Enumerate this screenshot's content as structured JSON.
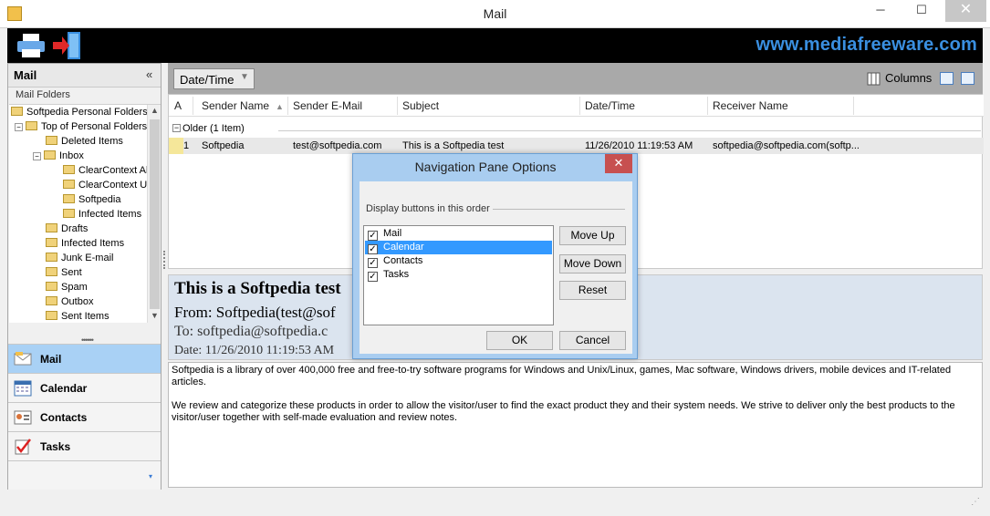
{
  "window": {
    "title": "Mail",
    "minimize": "─",
    "maximize": "☐",
    "close": "✕"
  },
  "banner": {
    "url": "www.mediafreeware.com"
  },
  "left": {
    "header": "Mail",
    "collapse": "«",
    "folders_label": "Mail Folders",
    "tree": [
      {
        "label": "Softpedia Personal Folders",
        "level": 0
      },
      {
        "label": "Top of Personal Folders",
        "level": 1
      },
      {
        "label": "Deleted Items",
        "level": 2
      },
      {
        "label": "Inbox",
        "level": 2
      },
      {
        "label": "ClearContext Al",
        "level": 3
      },
      {
        "label": "ClearContext U",
        "level": 3
      },
      {
        "label": "Softpedia",
        "level": 3
      },
      {
        "label": "Infected Items",
        "level": 3
      },
      {
        "label": "Drafts",
        "level": 2
      },
      {
        "label": "Infected Items",
        "level": 2
      },
      {
        "label": "Junk E-mail",
        "level": 2
      },
      {
        "label": "Sent",
        "level": 2
      },
      {
        "label": "Spam",
        "level": 2
      },
      {
        "label": "Outbox",
        "level": 2
      },
      {
        "label": "Sent Items",
        "level": 2
      }
    ],
    "nav": [
      "Mail",
      "Calendar",
      "Contacts",
      "Tasks"
    ]
  },
  "toolbar": {
    "group_by": "Date/Time",
    "columns": "Columns"
  },
  "grid": {
    "headers": [
      "A",
      "Sender Name",
      "Sender E-Mail",
      "Subject",
      "Date/Time",
      "Receiver Name"
    ],
    "group": "Older (1 Item)",
    "row": {
      "num": "1",
      "sender_name": "Softpedia",
      "sender_email": "test@softpedia.com",
      "subject": "This is a Softpedia test",
      "datetime": "11/26/2010 11:19:53 AM",
      "receiver": "softpedia@softpedia.com(softp..."
    }
  },
  "preview": {
    "subject": "This is a Softpedia test",
    "from": "From: Softpedia(test@sof",
    "to": "To: softpedia@softpedia.c",
    "date": "Date: 11/26/2010 11:19:53 AM",
    "body1": "Softpedia is a library of over 400,000 free and free-to-try software programs for Windows and Unix/Linux, games, Mac software, Windows drivers, mobile devices and IT-related articles.",
    "body2": "We review and categorize these products in order to allow the visitor/user to find the exact product they and their system needs. We strive to deliver only the best products to the visitor/user together with self-made evaluation and review notes."
  },
  "dialog": {
    "title": "Navigation Pane Options",
    "label": "Display buttons in this order",
    "items": [
      {
        "label": "Mail",
        "checked": true
      },
      {
        "label": "Calendar",
        "checked": true
      },
      {
        "label": "Contacts",
        "checked": true
      },
      {
        "label": "Tasks",
        "checked": true
      }
    ],
    "move_up": "Move Up",
    "move_down": "Move Down",
    "reset": "Reset",
    "ok": "OK",
    "cancel": "Cancel",
    "close": "✕"
  },
  "colors": {
    "selection": "#3399ff",
    "nav_active": "#a9d1f5",
    "banner_url": "#3a8fe0"
  }
}
